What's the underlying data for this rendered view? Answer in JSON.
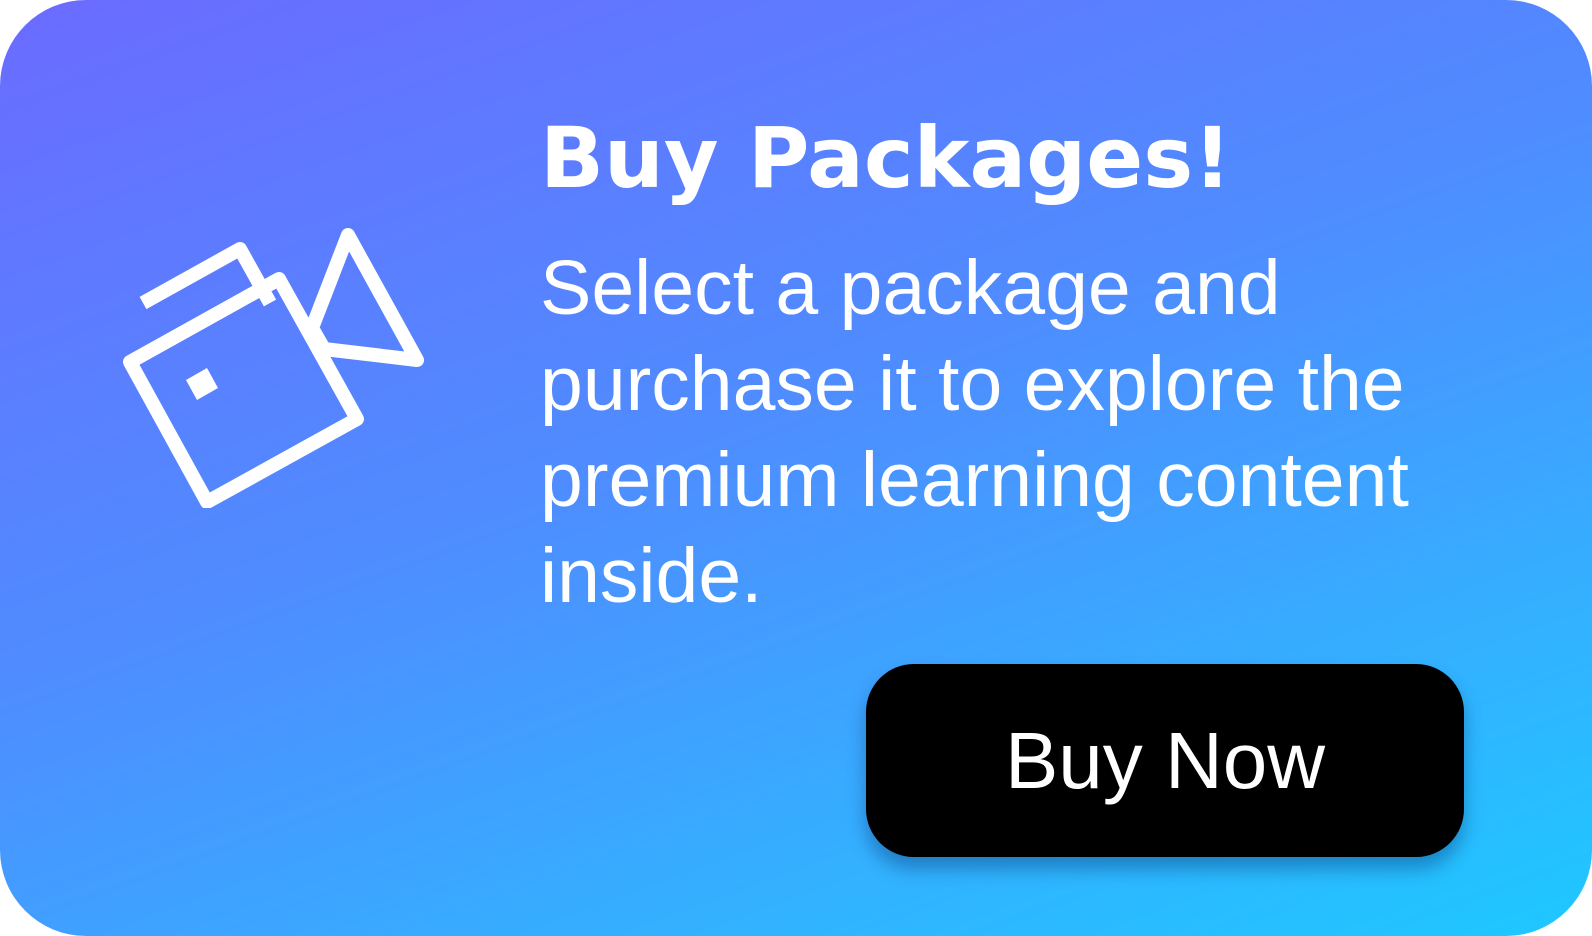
{
  "card": {
    "icon": "film-camera-icon",
    "title": "Buy Packages!",
    "description": "Select a package and purchase it to explore the premium learning content inside.",
    "button_label": "Buy Now",
    "colors": {
      "gradient_start": "#6b6bff",
      "gradient_end": "#1ec8ff",
      "button_background": "#000000",
      "text": "#ffffff"
    }
  }
}
